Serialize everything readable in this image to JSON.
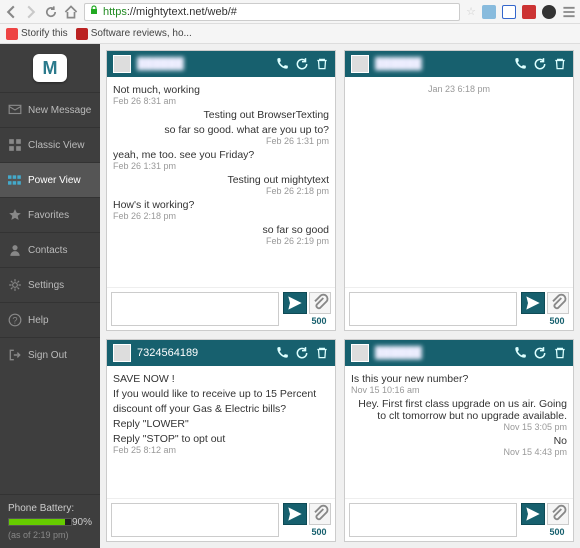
{
  "browser": {
    "url_prefix": "https",
    "url_rest": "://mightytext.net/web/#",
    "bookmarks": [
      "Storify this",
      "Software reviews, ho..."
    ]
  },
  "sidebar": {
    "logo_letter": "M",
    "items": [
      {
        "label": "New Message"
      },
      {
        "label": "Classic View"
      },
      {
        "label": "Power View"
      },
      {
        "label": "Favorites"
      },
      {
        "label": "Contacts"
      },
      {
        "label": "Settings"
      },
      {
        "label": "Help"
      },
      {
        "label": "Sign Out"
      }
    ],
    "battery": {
      "title": "Phone Battery:",
      "percent": "90%",
      "fill": 90,
      "asof": "(as of 2:19 pm)"
    }
  },
  "cards": [
    {
      "name": "",
      "name_clear": false,
      "messages": [
        {
          "side": "left",
          "text": "Not much, working",
          "date": "Feb 26 8:31 am"
        },
        {
          "side": "right",
          "text": "Testing out BrowserTexting",
          "date": ""
        },
        {
          "side": "right",
          "text": "so far so good. what are you up to?",
          "date": "Feb 26 1:31 pm"
        },
        {
          "side": "left",
          "text": "yeah, me too. see you Friday?",
          "date": "Feb 26 1:31 pm"
        },
        {
          "side": "right",
          "text": "Testing out mightytext",
          "date": "Feb 26 2:18 pm"
        },
        {
          "side": "left",
          "text": "How's it working?",
          "date": "Feb 26 2:18 pm"
        },
        {
          "side": "right",
          "text": "so far so good",
          "date": "Feb 26 2:19 pm"
        }
      ],
      "count": "500"
    },
    {
      "name": "",
      "name_clear": false,
      "messages": [
        {
          "side": "center",
          "text": "",
          "date": "Jan 23 6:18 pm"
        }
      ],
      "count": "500"
    },
    {
      "name": "7324564189",
      "name_clear": true,
      "messages": [
        {
          "side": "left",
          "text": "SAVE NOW !",
          "date": ""
        },
        {
          "side": "left",
          "text": "If you would like to receive up to 15 Percent",
          "date": ""
        },
        {
          "side": "left",
          "text": "discount off your Gas & Electric bills?",
          "date": ""
        },
        {
          "side": "left",
          "text": "Reply \"LOWER\"",
          "date": ""
        },
        {
          "side": "left",
          "text": "Reply \"STOP\" to opt out",
          "date": "Feb 25 8:12 am"
        }
      ],
      "count": "500"
    },
    {
      "name": "",
      "name_clear": false,
      "messages": [
        {
          "side": "left",
          "text": "Is this your new number?",
          "date": "Nov 15 10:16 am"
        },
        {
          "side": "right",
          "text": "Hey. First first class upgrade on us air. Going to clt tomorrow but no upgrade available.",
          "date": "Nov 15 3:05 pm"
        },
        {
          "side": "right",
          "text": "No",
          "date": "Nov 15 4:43 pm"
        }
      ],
      "count": "500"
    }
  ]
}
